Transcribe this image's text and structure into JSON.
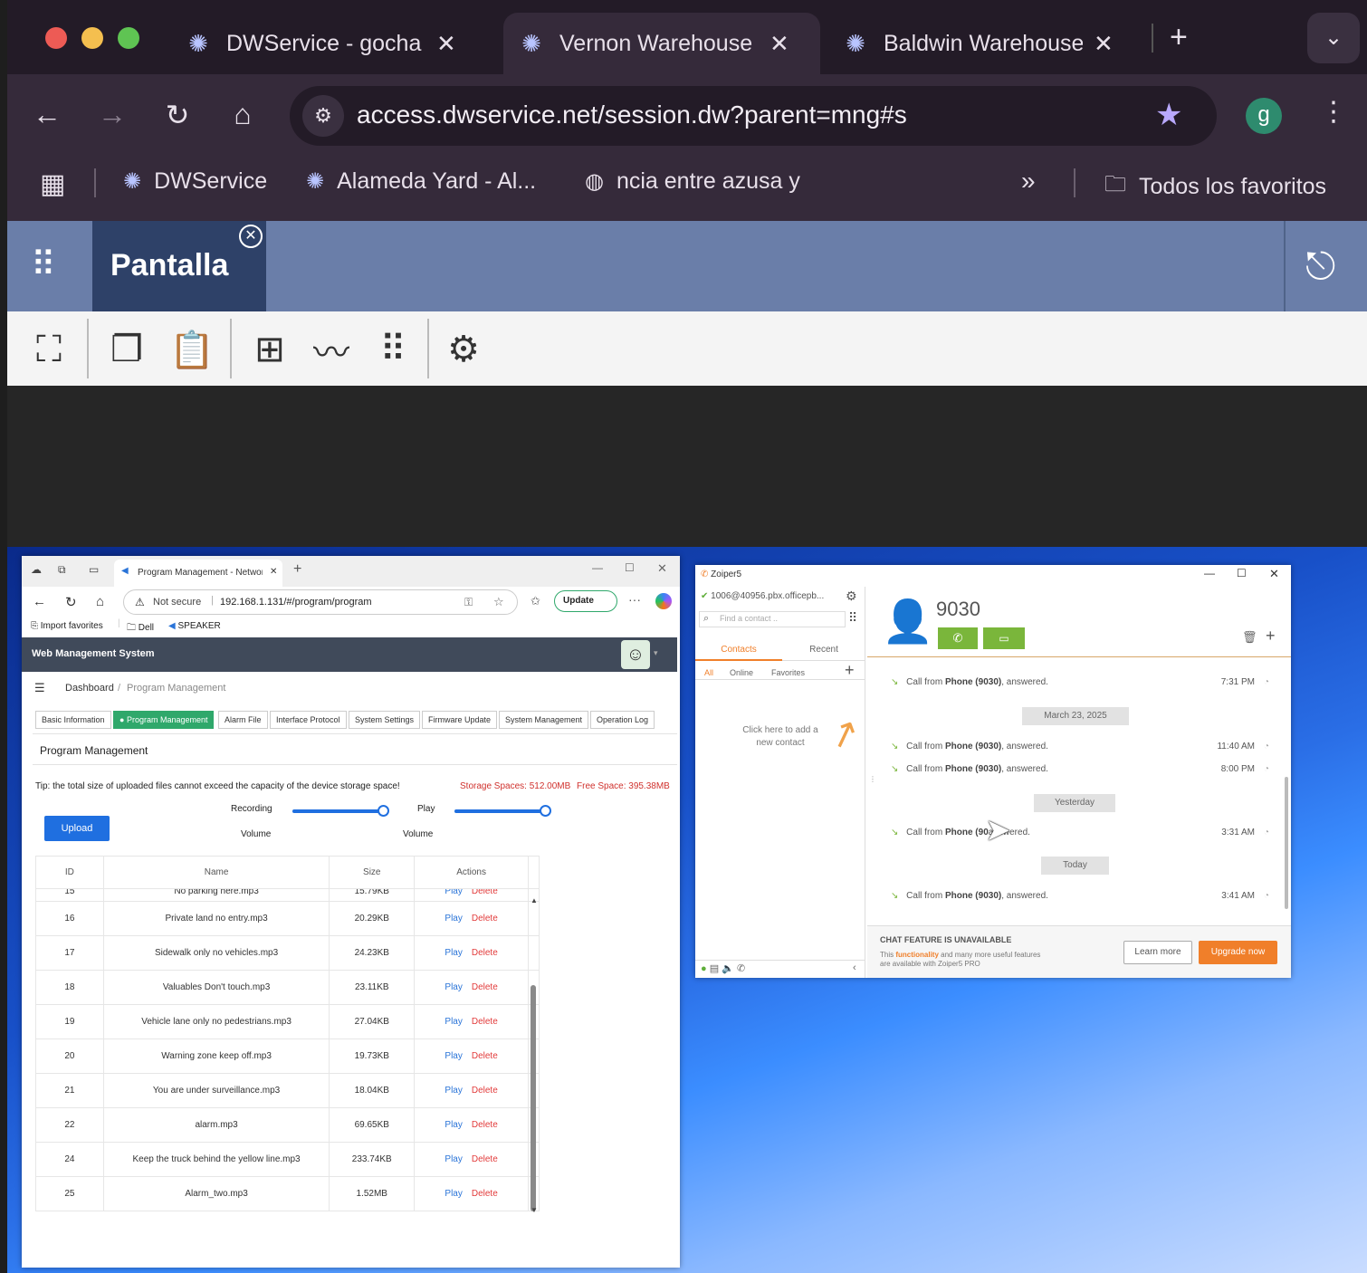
{
  "browser": {
    "tabs": [
      {
        "title": "DWService - gocha"
      },
      {
        "title": "Vernon Warehouse"
      },
      {
        "title": "Baldwin Warehouse"
      }
    ],
    "url": "access.dwservice.net/session.dw?parent=mng#s",
    "profile_initial": "g",
    "bookmarks": [
      {
        "label": "DWService"
      },
      {
        "label": "Alameda Yard - Al..."
      },
      {
        "label": "ncia entre azusa y"
      }
    ],
    "all_bookmarks": "Todos los favoritos"
  },
  "dwservice": {
    "tab_label": "Pantalla"
  },
  "edge": {
    "tab_title": "Program Management - Network",
    "not_secure": "Not secure",
    "url": "192.168.1.131/#/program/program",
    "update_label": "Update",
    "favorites": [
      "Import favorites",
      "Dell",
      "SPEAKER"
    ]
  },
  "wms": {
    "title": "Web Management System",
    "breadcrumb": {
      "home": "Dashboard",
      "current": "Program Management"
    },
    "tabs": [
      "Basic Information",
      "Program Management",
      "Alarm File",
      "Interface Protocol",
      "System Settings",
      "Firmware Update",
      "System Management",
      "Operation Log"
    ],
    "section_title": "Program Management",
    "tip": "Tip: the total size of uploaded files cannot exceed the capacity of the device storage space!",
    "storage": "Storage Spaces: 512.00MB",
    "free": "Free Space: 395.38MB",
    "upload_label": "Upload",
    "recording_label": "Recording",
    "volume_label": "Volume",
    "play_label": "Play",
    "volume2_label": "Volume",
    "recording_volume": 1.0,
    "play_volume": 1.0,
    "columns": [
      "ID",
      "Name",
      "Size",
      "Actions"
    ],
    "partial_row": {
      "id": "15",
      "name": "No parking here.mp3",
      "size": "15.79KB"
    },
    "rows": [
      {
        "id": "16",
        "name": "Private land no entry.mp3",
        "size": "20.29KB"
      },
      {
        "id": "17",
        "name": "Sidewalk only no vehicles.mp3",
        "size": "24.23KB"
      },
      {
        "id": "18",
        "name": "Valuables Don't touch.mp3",
        "size": "23.11KB"
      },
      {
        "id": "19",
        "name": "Vehicle lane only no pedestrians.mp3",
        "size": "27.04KB"
      },
      {
        "id": "20",
        "name": "Warning zone keep off.mp3",
        "size": "19.73KB"
      },
      {
        "id": "21",
        "name": "You are under surveillance.mp3",
        "size": "18.04KB"
      },
      {
        "id": "22",
        "name": "alarm.mp3",
        "size": "69.65KB"
      },
      {
        "id": "24",
        "name": "Keep the truck behind the yellow line.mp3",
        "size": "233.74KB"
      },
      {
        "id": "25",
        "name": "Alarm_two.mp3",
        "size": "1.52MB"
      }
    ],
    "play_action": "Play",
    "delete_action": "Delete"
  },
  "zoiper": {
    "title": "Zoiper5",
    "account": "1006@40956.pbx.officepb...",
    "search_placeholder": "Find a contact ..",
    "tabs": [
      "Contacts",
      "Recent"
    ],
    "subtabs": [
      "All",
      "Online",
      "Favorites"
    ],
    "add_contact_hint": "Click here to add a new contact",
    "contact_number": "9030",
    "log": [
      {
        "prefix": "Call from ",
        "bold": "Phone (9030)",
        "suffix": ", answered.",
        "time": "7:31 PM"
      },
      {
        "prefix": "Call from ",
        "bold": "Phone (9030)",
        "suffix": ", answered.",
        "time": "11:40 AM"
      },
      {
        "prefix": "Call from ",
        "bold": "Phone (9030)",
        "suffix": ", answered.",
        "time": "8:00 PM"
      },
      {
        "prefix": "Call from ",
        "bold": "Phone (90",
        "suffix": "answered.",
        "time": "3:31 AM"
      },
      {
        "prefix": "Call from ",
        "bold": "Phone (9030)",
        "suffix": ", answered.",
        "time": "3:41 AM"
      }
    ],
    "dates": [
      "March 23, 2025",
      "Yesterday",
      "Today"
    ],
    "chat_title": "CHAT FEATURE IS UNAVAILABLE",
    "chat_line1_a": "This ",
    "chat_line1_b": "functionality",
    "chat_line1_c": " and many more useful features",
    "chat_line2": "are available with Zoiper5 PRO",
    "learn_more": "Learn more",
    "upgrade_now": "Upgrade now"
  },
  "colors": {
    "accent_green": "#2fa86b",
    "upload_blue": "#1f6fe0",
    "storage_red": "#d0312d",
    "zoiper_orange": "#f07f2a",
    "call_green": "#7ab63b"
  }
}
